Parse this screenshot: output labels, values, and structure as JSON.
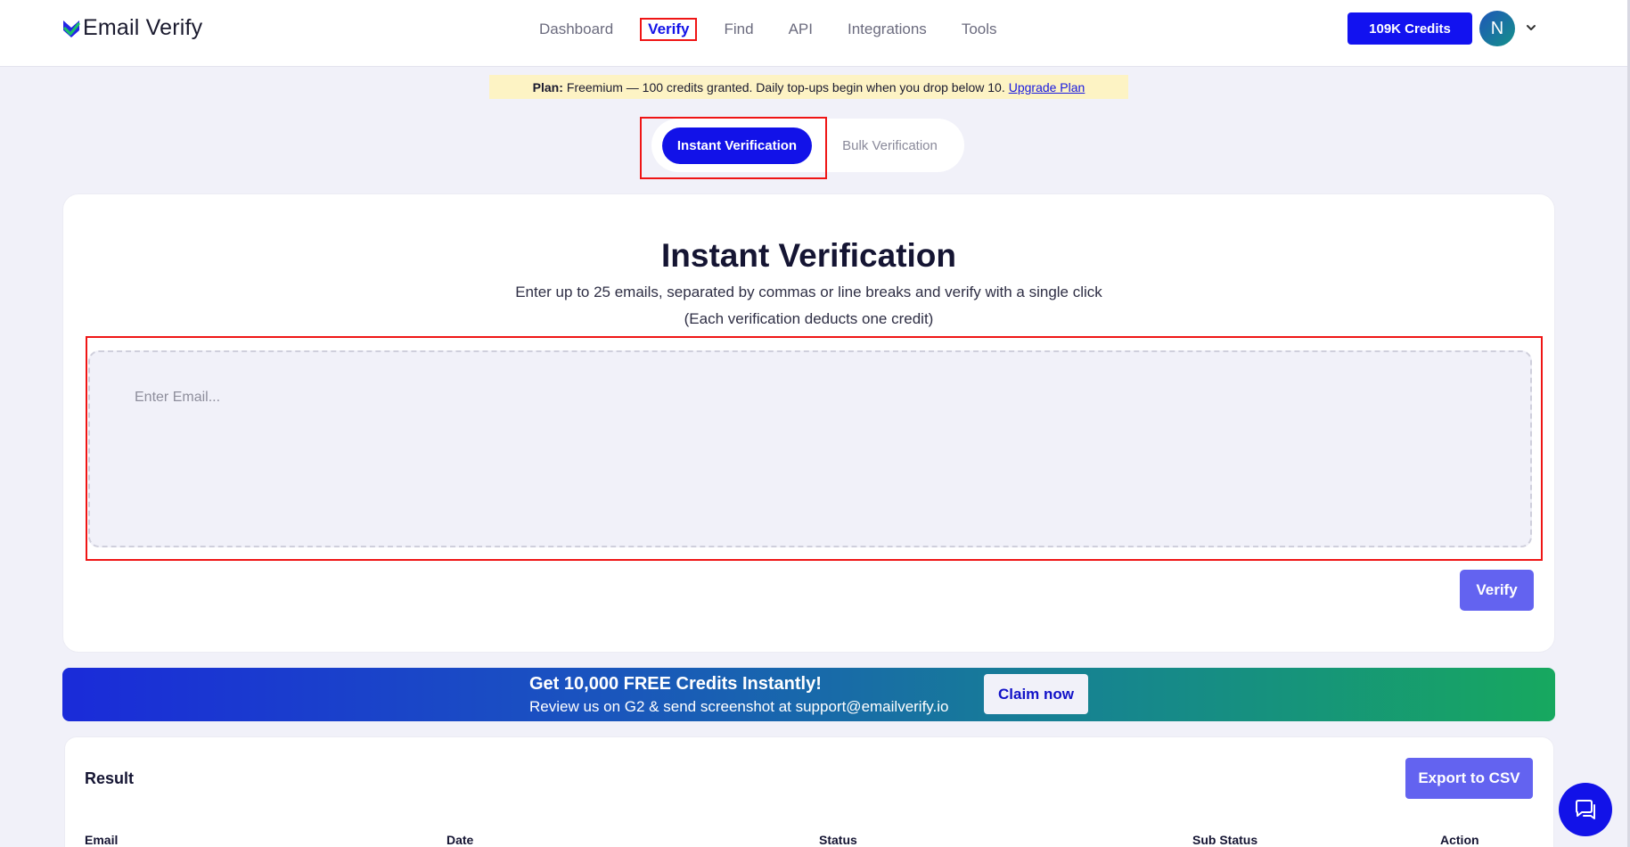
{
  "header": {
    "logo_text": "Email Verify",
    "nav": [
      {
        "label": "Dashboard",
        "active": false
      },
      {
        "label": "Verify",
        "active": true
      },
      {
        "label": "Find",
        "active": false
      },
      {
        "label": "API",
        "active": false
      },
      {
        "label": "Integrations",
        "active": false
      },
      {
        "label": "Tools",
        "active": false
      }
    ],
    "credits_label": "109K Credits",
    "avatar_initial": "N"
  },
  "plan": {
    "label": "Plan:",
    "text": "Freemium — 100 credits granted. Daily top-ups begin when you drop below 10.",
    "link": "Upgrade Plan"
  },
  "tabs": {
    "instant": "Instant Verification",
    "bulk": "Bulk Verification"
  },
  "main": {
    "title": "Instant Verification",
    "subtitle": "Enter up to 25 emails, separated by commas or line breaks and verify with a single click",
    "note": "(Each verification deducts one credit)",
    "email_placeholder": "Enter Email...",
    "verify_label": "Verify"
  },
  "promo": {
    "title": "Get 10,000 FREE Credits Instantly!",
    "subtitle": "Review us on G2 & send screenshot at support@emailverify.io",
    "claim_label": "Claim now"
  },
  "result": {
    "title": "Result",
    "export_label": "Export to CSV",
    "columns": [
      "Email",
      "Date",
      "Status",
      "Sub Status",
      "Action"
    ]
  },
  "colors": {
    "primary": "#1212e8",
    "secondary_button": "#6363f0",
    "background": "#f1f1f9",
    "highlight_border": "#ef1515",
    "plan_bg": "#fdf3c4"
  },
  "icons": [
    "logo-check-icon",
    "chevron-down-icon",
    "chat-icon"
  ]
}
